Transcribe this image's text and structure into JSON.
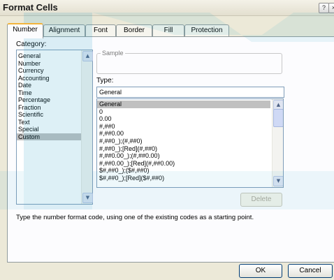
{
  "window": {
    "title": "Format Cells",
    "help_glyph": "?",
    "close_glyph": "×"
  },
  "tabs": [
    {
      "label": "Number",
      "active": true
    },
    {
      "label": "Alignment",
      "active": false
    },
    {
      "label": "Font",
      "active": false
    },
    {
      "label": "Border",
      "active": false
    },
    {
      "label": "Fill",
      "active": false
    },
    {
      "label": "Protection",
      "active": false
    }
  ],
  "category": {
    "label": "Category:",
    "items": [
      "General",
      "Number",
      "Currency",
      "Accounting",
      "Date",
      "Time",
      "Percentage",
      "Fraction",
      "Scientific",
      "Text",
      "Special",
      "Custom"
    ],
    "selected": "Custom"
  },
  "sample": {
    "legend": "Sample",
    "value": ""
  },
  "type": {
    "label": "Type:",
    "value": "General",
    "items": [
      "General",
      "0",
      "0.00",
      "#,##0",
      "#,##0.00",
      "#,##0_);(#,##0)",
      "#,##0_);[Red](#,##0)",
      "#,##0.00_);(#,##0.00)",
      "#,##0.00_);[Red](#,##0.00)",
      "$#,##0_);($#,##0)",
      "$#,##0_);[Red]($#,##0)"
    ],
    "selected": "General"
  },
  "buttons": {
    "delete": "Delete",
    "ok": "OK",
    "cancel": "Cancel"
  },
  "hint": "Type the number format code, using one of the existing codes as a starting point.",
  "colors": {
    "accent_tab": "#f2b43c",
    "list_selection": "#c0c0c0",
    "watermark": "#2aa3c8"
  }
}
